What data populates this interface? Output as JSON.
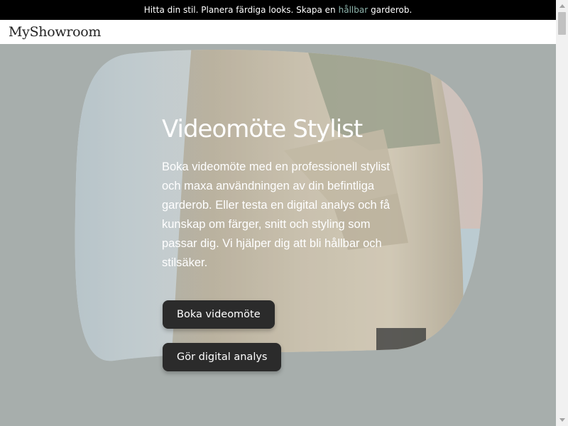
{
  "announcement": {
    "before": "Hitta din stil. Planera färdiga looks. Skapa en",
    "highlight": "hållbar",
    "after": "garderob."
  },
  "header": {
    "logo": "MyShowroom"
  },
  "hero": {
    "title": "Videomöte Stylist",
    "description": "Boka videomöte med en professionell stylist och maxa användningen av din befintliga garderob. Eller testa en digital analys och få kunskap om färger,  snitt och styling som passar dig. Vi hjälper dig att bli hållbar och stilsäker.",
    "primary_button": "Boka videomöte",
    "secondary_button": "Gör digital analys"
  },
  "colors": {
    "background": "#a7aeac",
    "highlight": "#8fb5ad",
    "button": "#2b2b2b",
    "topbar": "#000000"
  }
}
